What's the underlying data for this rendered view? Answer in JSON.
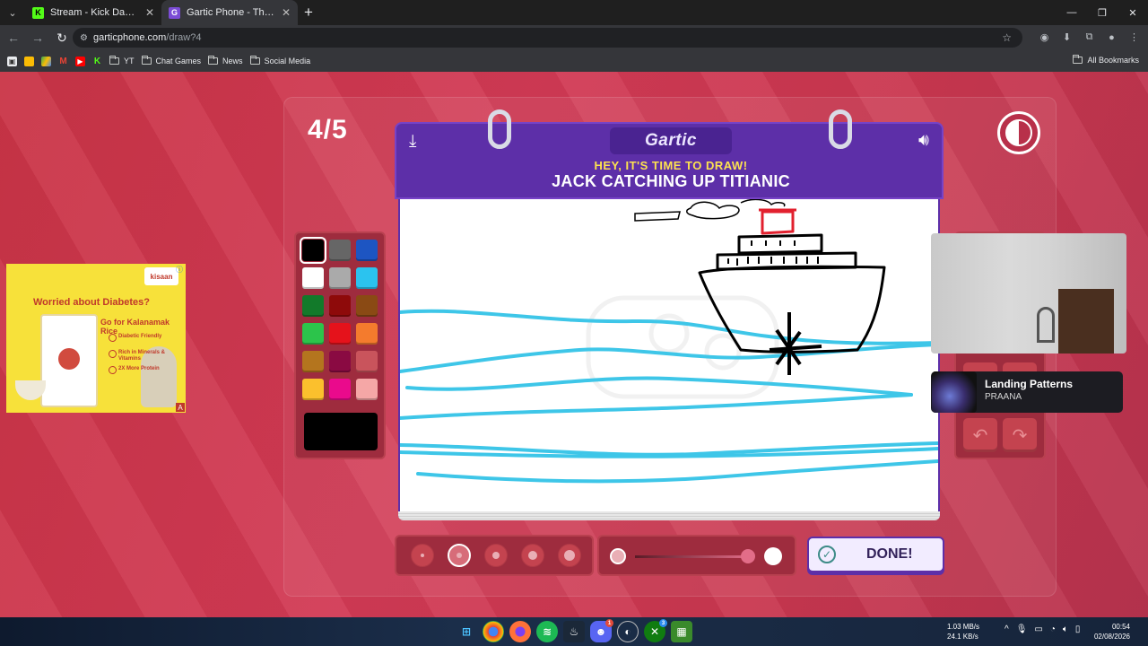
{
  "browser": {
    "tabs": [
      {
        "title": "Stream - Kick Dashboard",
        "favicon": "kick-icon",
        "color": "#53fc18",
        "active": false
      },
      {
        "title": "Gartic Phone - The Telephone G",
        "favicon": "gartic-icon",
        "color": "#7b4cd6",
        "active": true
      }
    ],
    "address": {
      "host": "garticphone.com",
      "path": "/draw?4"
    },
    "bookmarks": [
      {
        "label": "YT",
        "type": "folder"
      },
      {
        "label": "Chat Games",
        "type": "folder"
      },
      {
        "label": "News",
        "type": "folder"
      },
      {
        "label": "Social Media",
        "type": "folder"
      }
    ],
    "all_bookmarks": "All Bookmarks"
  },
  "game": {
    "round": "4/5",
    "logo": "Gartic",
    "prompt_small": "HEY, IT'S TIME TO DRAW!",
    "prompt_big": "JACK CATCHING UP TITIANIC",
    "done_label": "DONE!",
    "palette": [
      "#000000",
      "#666666",
      "#1d55c2",
      "#ffffff",
      "#aaaaaa",
      "#2bc3ef",
      "#127a2a",
      "#8e0a0a",
      "#8a4a14",
      "#2cc44b",
      "#e5121b",
      "#f47b2d",
      "#b4751e",
      "#8a0a42",
      "#c9545c",
      "#fbc02d",
      "#ea0a8c",
      "#f5a7a6"
    ],
    "selected_color": "#000000",
    "brush_sizes": [
      1,
      2,
      3,
      4,
      5
    ],
    "selected_size": 2
  },
  "ad": {
    "brand": "kisaan",
    "headline": "Worried about Diabetes?",
    "sub": "Go for Kalanamak Rice",
    "features": [
      "Diabetic Friendly",
      "Rich in Minerals & Vitamins",
      "2X More Protein"
    ]
  },
  "overlay": {
    "track": "Landing Patterns",
    "artist": "PRAANA"
  },
  "taskbar": {
    "net_up": "1.03 MB/s",
    "net_down": "24.1 KB/s",
    "time": "00:54",
    "date": "02/08/2026"
  }
}
